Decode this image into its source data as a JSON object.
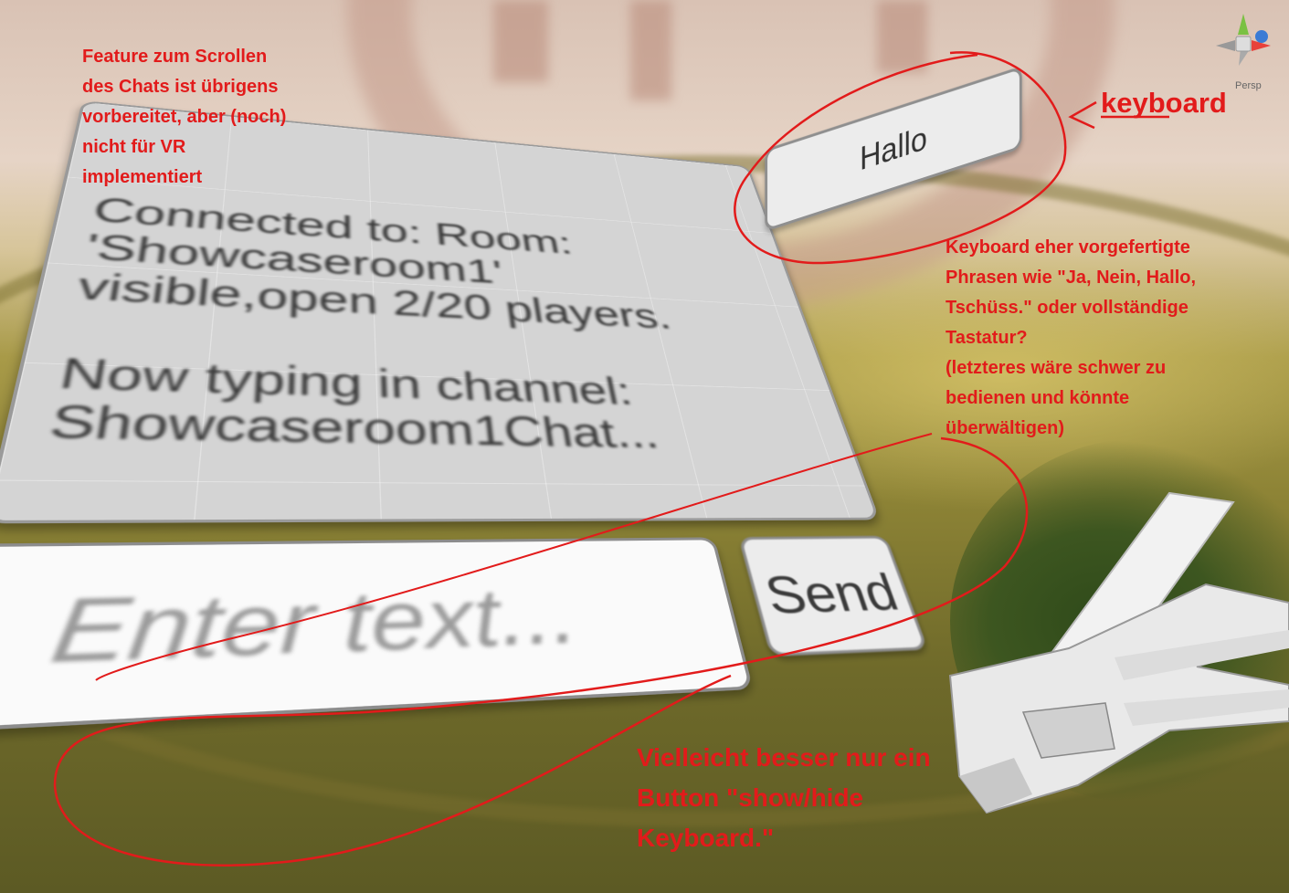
{
  "scene": {
    "gizmo_label": "Persp"
  },
  "chat": {
    "log_text": "Connected to: Room:\n'Showcaseroom1'\nvisible,open 2/20 players.\n\nNow typing in channel:\nShowcaseroom1Chat...",
    "input_placeholder": "Enter text...",
    "send_label": "Send",
    "preset_button_label": "Hallo"
  },
  "annotations": {
    "scroll_note": "Feature zum Scrollen\ndes Chats ist übrigens\nvorbereitet, aber (noch)\nnicht für VR\nimplementiert",
    "keyboard_label": "keyboard",
    "keyboard_question": "Keyboard eher vorgefertigte\nPhrasen wie \"Ja, Nein, Hallo,\nTschüss.\" oder vollständige\nTastatur?\n(letzteres wäre schwer zu\nbedienen und könnte\nüberwältigen)",
    "showhide_note": "Vielleicht besser nur ein\nButton \"show/hide\nKeyboard.\""
  },
  "colors": {
    "annotation_red": "#e21b1b",
    "panel_gray": "#d4d4d4"
  }
}
